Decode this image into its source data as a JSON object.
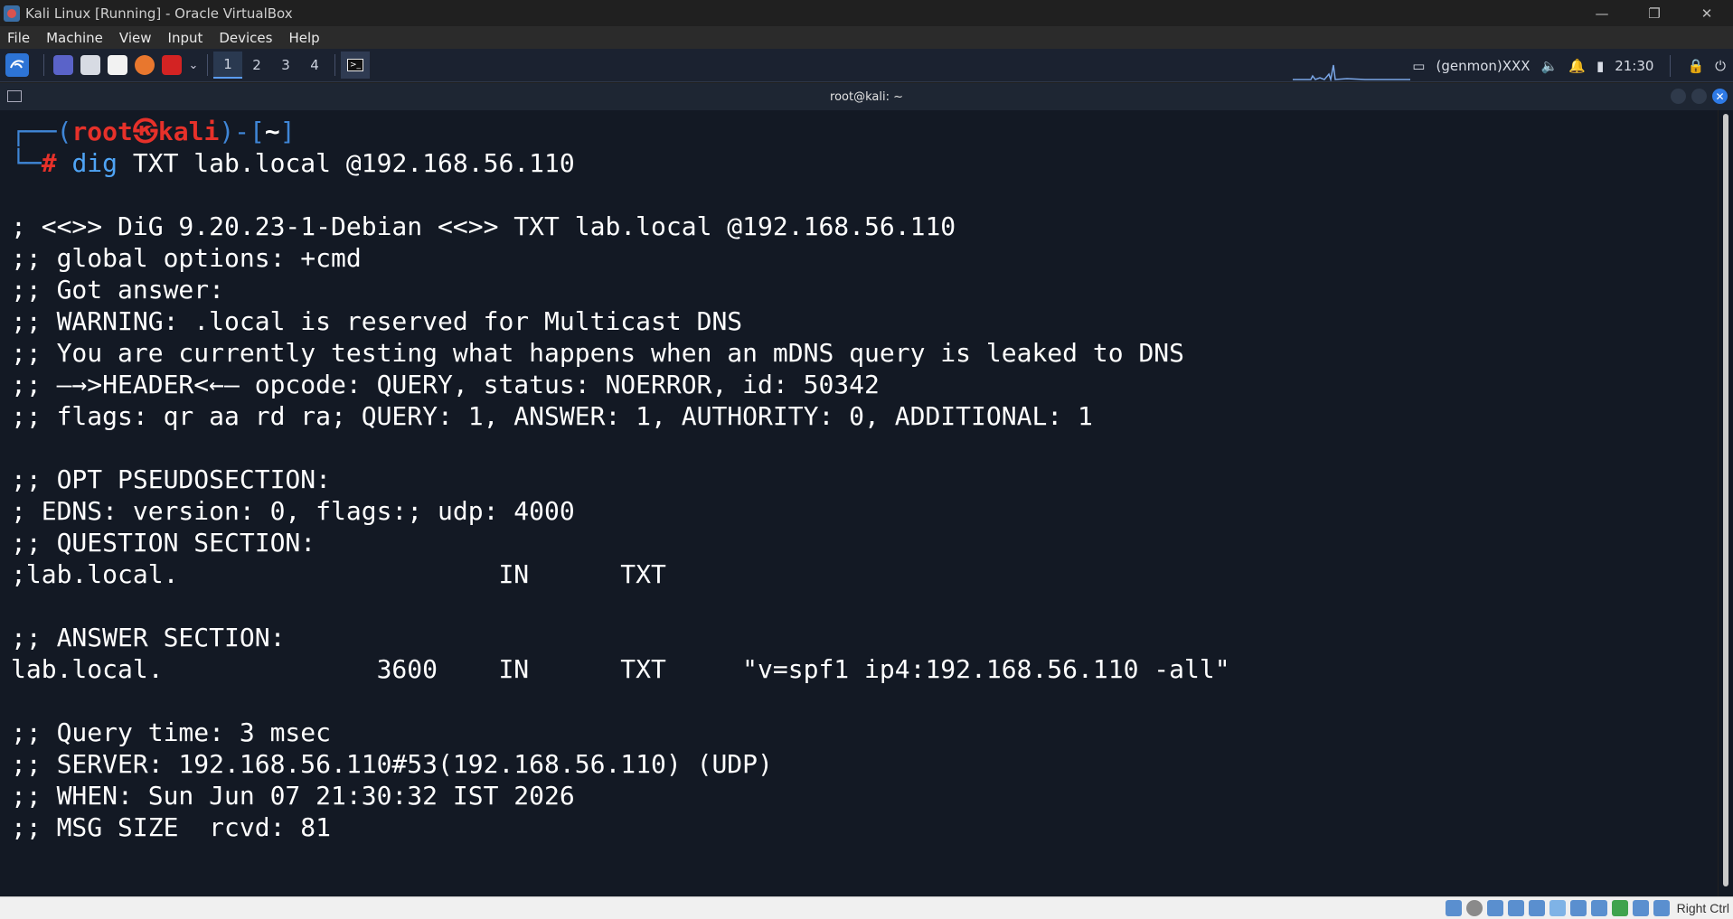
{
  "window": {
    "title": "Kali Linux [Running] - Oracle VirtualBox",
    "minimize": "—",
    "restore": "❐",
    "close": "✕"
  },
  "menu": [
    "File",
    "Machine",
    "View",
    "Input",
    "Devices",
    "Help"
  ],
  "panel": {
    "workspaces": [
      "1",
      "2",
      "3",
      "4"
    ],
    "active_workspace": "1",
    "genmon": "(genmon)XXX",
    "clock": "21:30"
  },
  "terminal": {
    "title": "root@kali: ~",
    "prompt": {
      "user": "root",
      "host": "kali",
      "skull": "㉿",
      "dir": "~",
      "command": "dig",
      "args": " TXT lab.local @192.168.56.110"
    },
    "output": [
      "",
      "; <<>> DiG 9.20.23-1-Debian <<>> TXT lab.local @192.168.56.110",
      ";; global options: +cmd",
      ";; Got answer:",
      ";; WARNING: .local is reserved for Multicast DNS",
      ";; You are currently testing what happens when an mDNS query is leaked to DNS",
      ";; —→>HEADER<←— opcode: QUERY, status: NOERROR, id: 50342",
      ";; flags: qr aa rd ra; QUERY: 1, ANSWER: 1, AUTHORITY: 0, ADDITIONAL: 1",
      "",
      ";; OPT PSEUDOSECTION:",
      "; EDNS: version: 0, flags:; udp: 4000",
      ";; QUESTION SECTION:",
      ";lab.local.                     IN      TXT",
      "",
      ";; ANSWER SECTION:",
      "lab.local.              3600    IN      TXT     \"v=spf1 ip4:192.168.56.110 -all\"",
      "",
      ";; Query time: 3 msec",
      ";; SERVER: 192.168.56.110#53(192.168.56.110) (UDP)",
      ";; WHEN: Sun Jun 07 21:30:32 IST 2026",
      ";; MSG SIZE  rcvd: 81"
    ]
  },
  "statusbar": {
    "host_key": "Right Ctrl"
  }
}
